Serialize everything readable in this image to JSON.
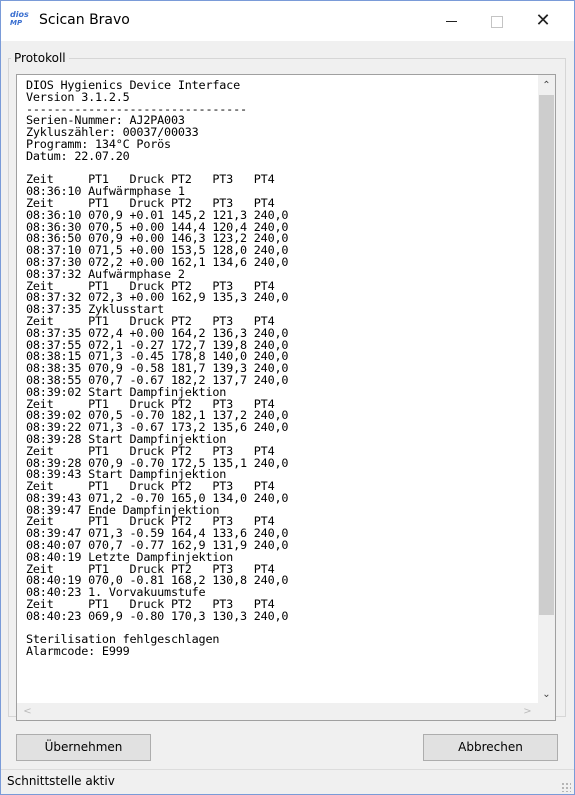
{
  "window": {
    "title": "Scican Bravo",
    "icon_line1": "dios",
    "icon_line2": "MP",
    "minimize_icon": "minimize-icon",
    "maximize_icon": "maximize-icon",
    "close_icon": "close-icon",
    "close_glyph": "✕"
  },
  "group": {
    "label": "Protokoll"
  },
  "log": {
    "lines": [
      "DIOS Hygienics Device Interface",
      "Version 3.1.2.5",
      "--------------------------------",
      "Serien-Nummer: AJ2PA003",
      "Zykluszähler: 00037/00033",
      "Programm: 134°C Porös",
      "Datum: 22.07.20",
      "",
      "Zeit     PT1   Druck PT2   PT3   PT4",
      "08:36:10 Aufwärmphase 1",
      "Zeit     PT1   Druck PT2   PT3   PT4",
      "08:36:10 070,9 +0.01 145,2 121,3 240,0",
      "08:36:30 070,5 +0.00 144,4 120,4 240,0",
      "08:36:50 070,9 +0.00 146,3 123,2 240,0",
      "08:37:10 071,5 +0.00 153,5 128,0 240,0",
      "08:37:30 072,2 +0.00 162,1 134,6 240,0",
      "08:37:32 Aufwärmphase 2",
      "Zeit     PT1   Druck PT2   PT3   PT4",
      "08:37:32 072,3 +0.00 162,9 135,3 240,0",
      "08:37:35 Zyklusstart",
      "Zeit     PT1   Druck PT2   PT3   PT4",
      "08:37:35 072,4 +0.00 164,2 136,3 240,0",
      "08:37:55 072,1 -0.27 172,7 139,8 240,0",
      "08:38:15 071,3 -0.45 178,8 140,0 240,0",
      "08:38:35 070,9 -0.58 181,7 139,3 240,0",
      "08:38:55 070,7 -0.67 182,2 137,7 240,0",
      "08:39:02 Start Dampfinjektion",
      "Zeit     PT1   Druck PT2   PT3   PT4",
      "08:39:02 070,5 -0.70 182,1 137,2 240,0",
      "08:39:22 071,3 -0.67 173,2 135,6 240,0",
      "08:39:28 Start Dampfinjektion",
      "Zeit     PT1   Druck PT2   PT3   PT4",
      "08:39:28 070,9 -0.70 172,5 135,1 240,0",
      "08:39:43 Start Dampfinjektion",
      "Zeit     PT1   Druck PT2   PT3   PT4",
      "08:39:43 071,2 -0.70 165,0 134,0 240,0",
      "08:39:47 Ende Dampfinjektion",
      "Zeit     PT1   Druck PT2   PT3   PT4",
      "08:39:47 071,3 -0.59 164,4 133,6 240,0",
      "08:40:07 070,7 -0.77 162,9 131,9 240,0",
      "08:40:19 Letzte Dampfinjektion",
      "Zeit     PT1   Druck PT2   PT3   PT4",
      "08:40:19 070,0 -0.81 168,2 130,8 240,0",
      "08:40:23 1. Vorvakuumstufe",
      "Zeit     PT1   Druck PT2   PT3   PT4",
      "08:40:23 069,9 -0.80 170,3 130,3 240,0",
      "",
      "Sterilisation fehlgeschlagen",
      "Alarmcode: E999"
    ]
  },
  "scroll": {
    "up_glyph": "⌃",
    "down_glyph": "⌄",
    "left_glyph": "<",
    "right_glyph": ">"
  },
  "buttons": {
    "apply_label": "Übernehmen",
    "cancel_label": "Abbrechen"
  },
  "status": {
    "text": "Schnittstelle aktiv"
  }
}
